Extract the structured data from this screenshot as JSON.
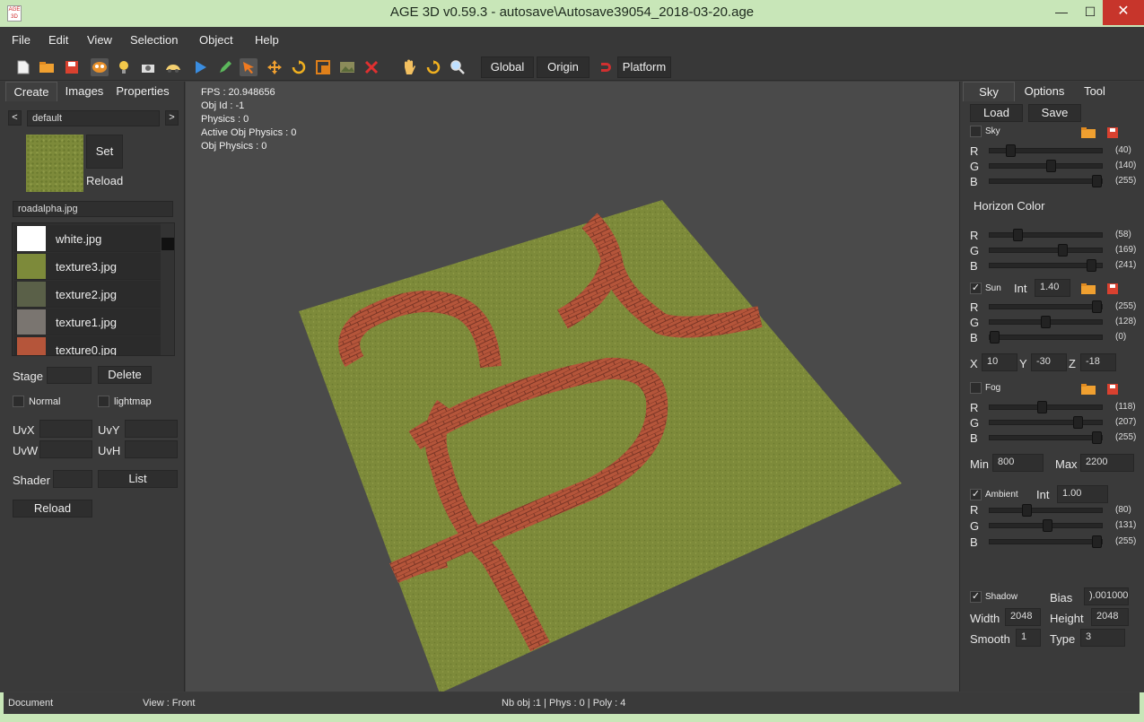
{
  "window": {
    "title": "AGE 3D v0.59.3 - autosave\\Autosave39054_2018-03-20.age",
    "minimize": "—",
    "maximize": "☐",
    "close": "✕"
  },
  "menu": [
    "File",
    "Edit",
    "View",
    "Selection",
    "Object",
    "Help"
  ],
  "toolbar": {
    "icons": [
      "new-file-icon",
      "open-folder-icon",
      "save-icon",
      "object-icon",
      "light-bulb-icon",
      "camera-icon",
      "vehicle-icon",
      "play-icon",
      "pencil-icon",
      "select-arrow-icon",
      "move-icon",
      "rotate-icon",
      "scale-icon",
      "image-icon",
      "delete-icon",
      "hand-icon",
      "undo-rotate-icon",
      "zoom-icon"
    ],
    "global_label": "Global",
    "origin_label": "Origin",
    "platform_label": "Platform"
  },
  "left": {
    "tabs": [
      "Create",
      "Images",
      "Properties"
    ],
    "nav_prev": "<",
    "nav_next": ">",
    "category": "default",
    "set_label": "Set",
    "reload_label": "Reload",
    "current_file": "roadalpha.jpg",
    "textures": [
      {
        "name": "white.jpg",
        "color": "#ffffff"
      },
      {
        "name": "texture3.jpg",
        "color": "#7d8a3a"
      },
      {
        "name": "texture2.jpg",
        "color": "#5a6048"
      },
      {
        "name": "texture1.jpg",
        "color": "#7a7570"
      },
      {
        "name": "texture0.jpg",
        "color": "#b5553a"
      }
    ],
    "stage_label": "Stage",
    "delete_label": "Delete",
    "normal_label": "Normal",
    "lightmap_label": "lightmap",
    "uvx_label": "UvX",
    "uvy_label": "UvY",
    "uvw_label": "UvW",
    "uvh_label": "UvH",
    "shader_label": "Shader",
    "list_label": "List",
    "reload2_label": "Reload"
  },
  "viewport": {
    "stats": [
      "FPS : 20.948656",
      "Obj Id : -1",
      "Physics : 0",
      "Active Obj Physics : 0",
      "Obj Physics : 0"
    ]
  },
  "right": {
    "tabs": [
      "Sky",
      "Options",
      "Tool"
    ],
    "load_label": "Load",
    "save_label": "Save",
    "sky": {
      "label": "Sky",
      "checked": false,
      "r": "(40)",
      "g": "(140)",
      "b": "(255)",
      "rv": 40,
      "gv": 140,
      "bv": 255
    },
    "horizon": {
      "label": "Horizon Color",
      "r": "(58)",
      "g": "(169)",
      "b": "(241)",
      "rv": 58,
      "gv": 169,
      "bv": 241
    },
    "sun": {
      "label": "Sun",
      "checked": true,
      "int_label": "Int",
      "int": "1.40",
      "r": "(255)",
      "g": "(128)",
      "b": "(0)",
      "rv": 255,
      "gv": 128,
      "bv": 0
    },
    "pos": {
      "x_label": "X",
      "x": "10",
      "y_label": "Y",
      "y": "-30",
      "z_label": "Z",
      "z": "-18"
    },
    "fog": {
      "label": "Fog",
      "checked": false,
      "r": "(118)",
      "g": "(207)",
      "b": "(255)",
      "rv": 118,
      "gv": 207,
      "bv": 255
    },
    "fogrange": {
      "min_label": "Min",
      "min": "800",
      "max_label": "Max",
      "max": "2200"
    },
    "ambient": {
      "label": "Ambient",
      "checked": true,
      "int_label": "Int",
      "int": "1.00",
      "r": "(80)",
      "g": "(131)",
      "b": "(255)",
      "rv": 80,
      "gv": 131,
      "bv": 255
    },
    "shadow": {
      "label": "Shadow",
      "checked": true,
      "bias_label": "Bias",
      "bias": ").001000",
      "width_label": "Width",
      "width": "2048",
      "height_label": "Height",
      "height": "2048",
      "smooth_label": "Smooth",
      "smooth": "1",
      "type_label": "Type",
      "type": "3"
    },
    "rgb_labels": [
      "R",
      "G",
      "B"
    ]
  },
  "status": {
    "document": "Document",
    "view": "View : Front",
    "counts": "Nb obj :1 | Phys : 0 | Poly : 4"
  },
  "colors": {
    "titlebar": "#c8e6b8",
    "grass": "#7d8a3a",
    "brick": "#b5553a",
    "close_button": "#c7352b"
  }
}
